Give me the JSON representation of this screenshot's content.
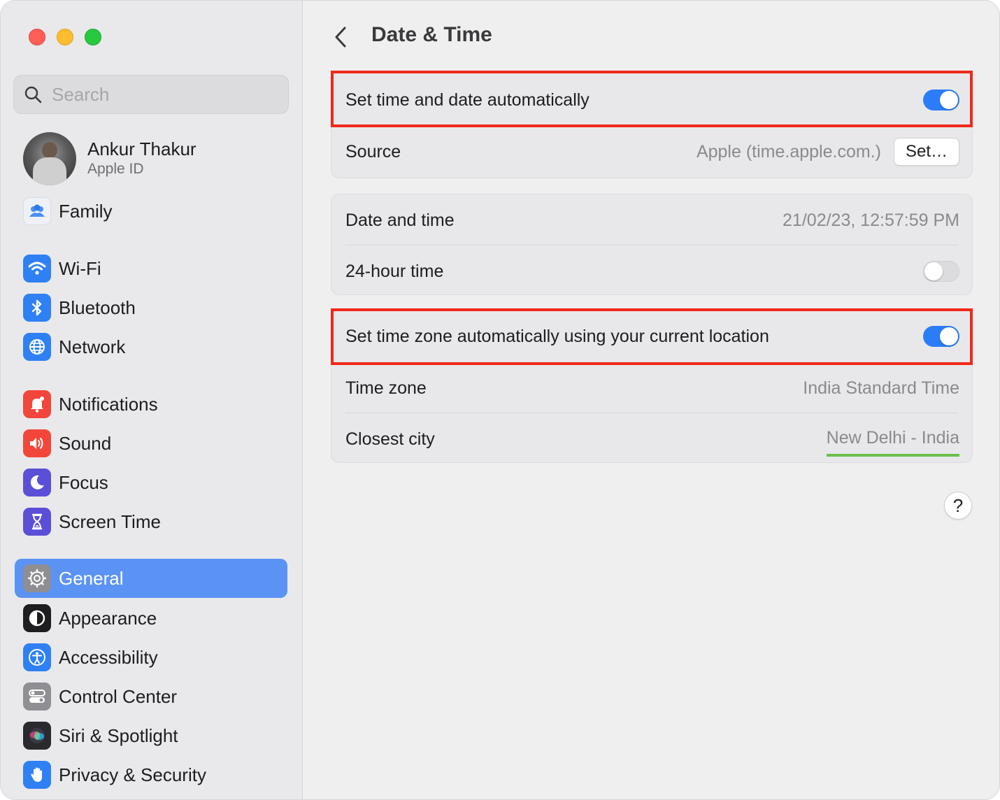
{
  "window": {
    "traffic_lights": {
      "close": "#ff5f57",
      "minimize": "#febc2e",
      "maximize": "#28c840"
    }
  },
  "sidebar": {
    "search_placeholder": "Search",
    "profile": {
      "name": "Ankur Thakur",
      "subtitle": "Apple ID"
    },
    "items": [
      {
        "label": "Family",
        "icon": "family-icon",
        "color": "#eef2f7"
      },
      {
        "label": "Wi-Fi",
        "icon": "wifi-icon",
        "color": "#2f80f3"
      },
      {
        "label": "Bluetooth",
        "icon": "bluetooth-icon",
        "color": "#2f80f3"
      },
      {
        "label": "Network",
        "icon": "globe-icon",
        "color": "#2f80f3"
      },
      {
        "label": "Notifications",
        "icon": "bell-icon",
        "color": "#f2463b"
      },
      {
        "label": "Sound",
        "icon": "speaker-icon",
        "color": "#f2463b"
      },
      {
        "label": "Focus",
        "icon": "moon-icon",
        "color": "#5b4fd8"
      },
      {
        "label": "Screen Time",
        "icon": "hourglass-icon",
        "color": "#5b4fd8"
      },
      {
        "label": "General",
        "icon": "gear-icon",
        "color": "#8e8e93",
        "selected": true
      },
      {
        "label": "Appearance",
        "icon": "appearance-icon",
        "color": "#1d1d1f"
      },
      {
        "label": "Accessibility",
        "icon": "accessibility-icon",
        "color": "#2f80f3"
      },
      {
        "label": "Control Center",
        "icon": "control-center-icon",
        "color": "#8e8e93"
      },
      {
        "label": "Siri & Spotlight",
        "icon": "siri-icon",
        "color": "#2a2a2e"
      },
      {
        "label": "Privacy & Security",
        "icon": "hand-icon",
        "color": "#2f80f3"
      }
    ]
  },
  "main": {
    "title": "Date & Time",
    "group1": {
      "auto_time_label": "Set time and date automatically",
      "auto_time_on": true,
      "source_label": "Source",
      "source_value": "Apple (time.apple.com.)",
      "set_button": "Set…"
    },
    "group2": {
      "date_time_label": "Date and time",
      "date_time_value": "21/02/23, 12:57:59 PM",
      "hour24_label": "24-hour time",
      "hour24_on": false
    },
    "group3": {
      "auto_tz_label": "Set time zone automatically using your current location",
      "auto_tz_on": true,
      "tz_label": "Time zone",
      "tz_value": "India Standard Time",
      "city_label": "Closest city",
      "city_value": "New Delhi - India"
    },
    "help_label": "?",
    "colors": {
      "toggle_on": "#2a7df6",
      "highlight": "#f0291a",
      "underline": "#6cc04a",
      "selected": "#5b93f5"
    }
  }
}
